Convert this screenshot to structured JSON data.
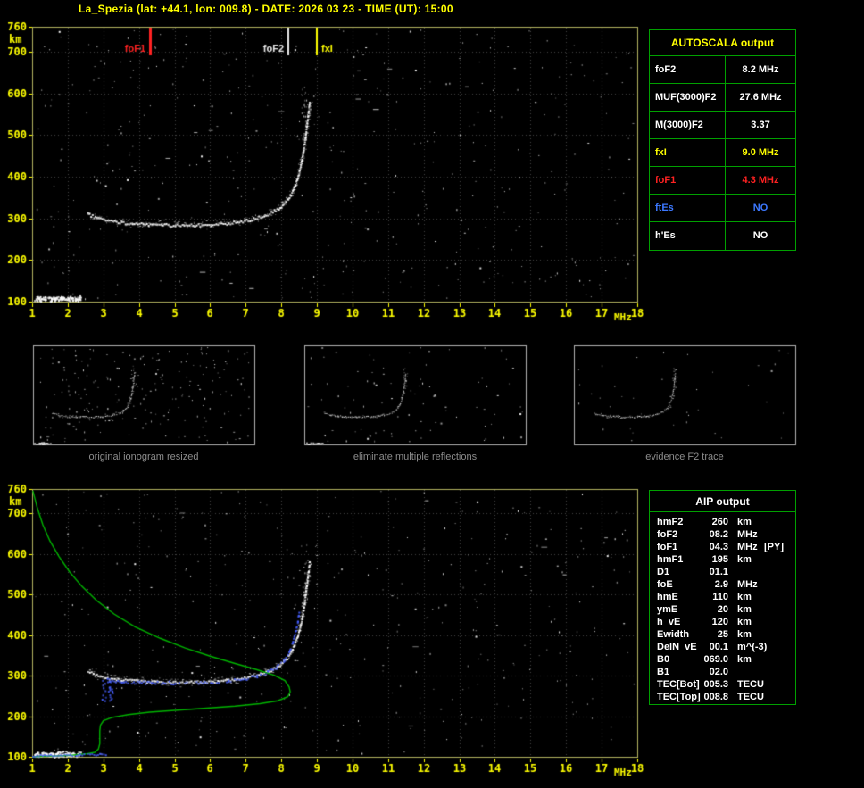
{
  "title": "La_Spezia (lat: +44.1, lon: 009.8) - DATE: 2026 03 23 - TIME (UT): 15:00",
  "colors": {
    "background": "#000000",
    "title_text": "#ffff00",
    "axis_text": "#ffff00",
    "plot_border": "#b5b560",
    "grid": "#454545",
    "table_border": "#00a000",
    "caption_text": "#8c8c8c",
    "trace_white": "#ffffff",
    "profile_green": "#00b400",
    "trace_blue": "#465fff",
    "marker_red": "#ff2222",
    "marker_white": "#e8e8e8",
    "marker_yellow": "#ffff00"
  },
  "autoscala": {
    "title": "AUTOSCALA output",
    "rows": [
      {
        "label": "foF2",
        "value": "8.2 MHz",
        "color": "#ffffff"
      },
      {
        "label": "MUF(3000)F2",
        "value": "27.6 MHz",
        "color": "#ffffff"
      },
      {
        "label": "M(3000)F2",
        "value": "3.37",
        "color": "#ffffff"
      },
      {
        "label": "fxI",
        "value": "9.0 MHz",
        "color": "#ffff00"
      },
      {
        "label": "foF1",
        "value": "4.3 MHz",
        "color": "#ff2222"
      },
      {
        "label": "ftEs",
        "value": "NO",
        "color": "#3c78ff"
      },
      {
        "label": "h'Es",
        "value": "NO",
        "color": "#ffffff"
      }
    ]
  },
  "aip": {
    "title": "AIP output",
    "rows": [
      {
        "label": "hmF2",
        "value": "260",
        "unit": "km",
        "note": ""
      },
      {
        "label": "foF2",
        "value": "08.2",
        "unit": "MHz",
        "note": ""
      },
      {
        "label": "foF1",
        "value": "04.3",
        "unit": "MHz",
        "note": "[PY]"
      },
      {
        "label": "hmF1",
        "value": "195",
        "unit": "km",
        "note": ""
      },
      {
        "label": "D1",
        "value": "01.1",
        "unit": "",
        "note": ""
      },
      {
        "label": "foE",
        "value": "2.9",
        "unit": "MHz",
        "note": ""
      },
      {
        "label": "hmE",
        "value": "110",
        "unit": "km",
        "note": ""
      },
      {
        "label": "ymE",
        "value": "20",
        "unit": "km",
        "note": ""
      },
      {
        "label": "h_vE",
        "value": "120",
        "unit": "km",
        "note": ""
      },
      {
        "label": "Ewidth",
        "value": "25",
        "unit": "km",
        "note": ""
      },
      {
        "label": "DelN_vE",
        "value": "00.1",
        "unit": "m^(-3)",
        "note": ""
      },
      {
        "label": "B0",
        "value": "069.0",
        "unit": "km",
        "note": ""
      },
      {
        "label": "B1",
        "value": "02.0",
        "unit": "",
        "note": ""
      },
      {
        "label": "TEC[Bot]",
        "value": "005.3",
        "unit": "TECU",
        "note": ""
      },
      {
        "label": "TEC[Top]",
        "value": "008.8",
        "unit": "TECU",
        "note": ""
      }
    ]
  },
  "thumbnails": {
    "captions": [
      "original ionogram resized",
      "eliminate multiple reflections",
      "evidence F2 trace"
    ]
  },
  "chart_data": [
    {
      "id": "main_ionogram",
      "type": "scatter",
      "canvas": "cv-top",
      "plot": [
        36,
        8,
        714,
        316
      ],
      "xlim": [
        1,
        18
      ],
      "ylim": [
        100,
        760
      ],
      "x_ticks": [
        1,
        2,
        3,
        4,
        5,
        6,
        7,
        8,
        9,
        10,
        11,
        12,
        13,
        14,
        15,
        16,
        17,
        18
      ],
      "y_ticks": [
        100,
        200,
        300,
        400,
        500,
        600,
        700,
        760
      ],
      "xlabel": "MHz",
      "ylabel": "km",
      "grid": true,
      "labels": true,
      "noise_seed": 11,
      "noise_count": 430,
      "streaks": 14,
      "markers": [
        {
          "label": "foF1",
          "freq": 4.3,
          "color": "#ff2222",
          "lw": 3
        },
        {
          "label": "foF2",
          "freq": 8.2,
          "color": "#e8e8e8",
          "lw": 2
        },
        {
          "label": "fxI",
          "freq": 9.0,
          "color": "#ffff00",
          "lw": 2,
          "align": "right"
        }
      ],
      "f_trace": [
        [
          2.55,
          312
        ],
        [
          2.8,
          302
        ],
        [
          3.1,
          296
        ],
        [
          3.5,
          291
        ],
        [
          4.0,
          288
        ],
        [
          4.5,
          286
        ],
        [
          5.0,
          285
        ],
        [
          5.6,
          285
        ],
        [
          6.0,
          286
        ],
        [
          6.4,
          289
        ],
        [
          6.8,
          293
        ],
        [
          7.1,
          298
        ],
        [
          7.4,
          305
        ],
        [
          7.7,
          315
        ],
        [
          7.95,
          328
        ],
        [
          8.15,
          345
        ],
        [
          8.3,
          366
        ],
        [
          8.42,
          392
        ],
        [
          8.52,
          424
        ],
        [
          8.6,
          460
        ],
        [
          8.66,
          498
        ],
        [
          8.71,
          532
        ],
        [
          8.75,
          562
        ],
        [
          8.78,
          584
        ]
      ],
      "e_blob": {
        "f0": 1.05,
        "f1": 2.35,
        "h": 108
      },
      "spread": {
        "f": 8.64,
        "h0": 480,
        "h1": 625,
        "count": 22
      }
    },
    {
      "id": "profile_ionogram",
      "type": "scatter",
      "canvas": "cv-bottom",
      "inherit": true,
      "plot": [
        36,
        8,
        714,
        308
      ],
      "grid": true,
      "labels": true,
      "noise_seed": 29,
      "noise_count": 390,
      "streaks": 12,
      "profile": [
        [
          1.02,
          756
        ],
        [
          1.15,
          712
        ],
        [
          1.3,
          672
        ],
        [
          1.5,
          632
        ],
        [
          1.75,
          594
        ],
        [
          2.05,
          556
        ],
        [
          2.4,
          520
        ],
        [
          2.8,
          486
        ],
        [
          3.3,
          452
        ],
        [
          3.9,
          420
        ],
        [
          4.6,
          392
        ],
        [
          5.3,
          368
        ],
        [
          6.0,
          348
        ],
        [
          6.7,
          330
        ],
        [
          7.3,
          315
        ],
        [
          7.8,
          301
        ],
        [
          8.1,
          288
        ],
        [
          8.22,
          272
        ],
        [
          8.25,
          260
        ],
        [
          8.18,
          248
        ],
        [
          7.9,
          238
        ],
        [
          7.4,
          231
        ],
        [
          6.7,
          225
        ],
        [
          5.9,
          220
        ],
        [
          5.1,
          215
        ],
        [
          4.3,
          210
        ],
        [
          3.7,
          204
        ],
        [
          3.25,
          197
        ],
        [
          3.0,
          189
        ],
        [
          2.92,
          178
        ],
        [
          2.9,
          164
        ],
        [
          2.9,
          148
        ],
        [
          2.9,
          132
        ],
        [
          2.86,
          119
        ],
        [
          2.76,
          111
        ],
        [
          2.5,
          107
        ],
        [
          2.1,
          104
        ],
        [
          1.6,
          102
        ],
        [
          1.2,
          101
        ],
        [
          1.02,
          100
        ]
      ],
      "blue": {
        "e_line": [
          [
            1.0,
            104
          ],
          [
            3.05,
            108
          ]
        ],
        "f_dots": [
          [
            3.05,
            288
          ],
          [
            3.5,
            286
          ],
          [
            4.0,
            285
          ],
          [
            4.5,
            284
          ],
          [
            5.0,
            284
          ],
          [
            5.6,
            285
          ],
          [
            6.0,
            286
          ],
          [
            6.5,
            289
          ],
          [
            7.0,
            295
          ],
          [
            7.3,
            301
          ],
          [
            7.6,
            310
          ],
          [
            7.85,
            322
          ],
          [
            8.05,
            338
          ],
          [
            8.2,
            358
          ],
          [
            8.3,
            382
          ],
          [
            8.38,
            408
          ],
          [
            8.44,
            434
          ],
          [
            8.48,
            458
          ]
        ],
        "cluster": {
          "f0": 2.95,
          "f1": 3.25,
          "h0": 235,
          "h1": 300,
          "count": 28
        }
      }
    },
    {
      "id": "thumb_original",
      "type": "scatter",
      "canvas": "cv-t1",
      "inherit": true,
      "plot": [
        2,
        2,
        250,
        113
      ],
      "grid": false,
      "labels": false,
      "border_color": "#b4b4b4",
      "noise_seed": 5,
      "noise_count": 210
    },
    {
      "id": "thumb_no_multiples",
      "type": "scatter",
      "canvas": "cv-t2",
      "inherit": true,
      "plot": [
        2,
        2,
        250,
        113
      ],
      "grid": false,
      "labels": false,
      "border_color": "#b4b4b4",
      "noise_seed": 6,
      "noise_count": 90
    },
    {
      "id": "thumb_f2_trace",
      "type": "scatter",
      "canvas": "cv-t3",
      "inherit": true,
      "plot": [
        2,
        2,
        250,
        113
      ],
      "grid": false,
      "labels": false,
      "border_color": "#b4b4b4",
      "noise_seed": 8,
      "noise_count": 40,
      "no_blob": true
    }
  ]
}
